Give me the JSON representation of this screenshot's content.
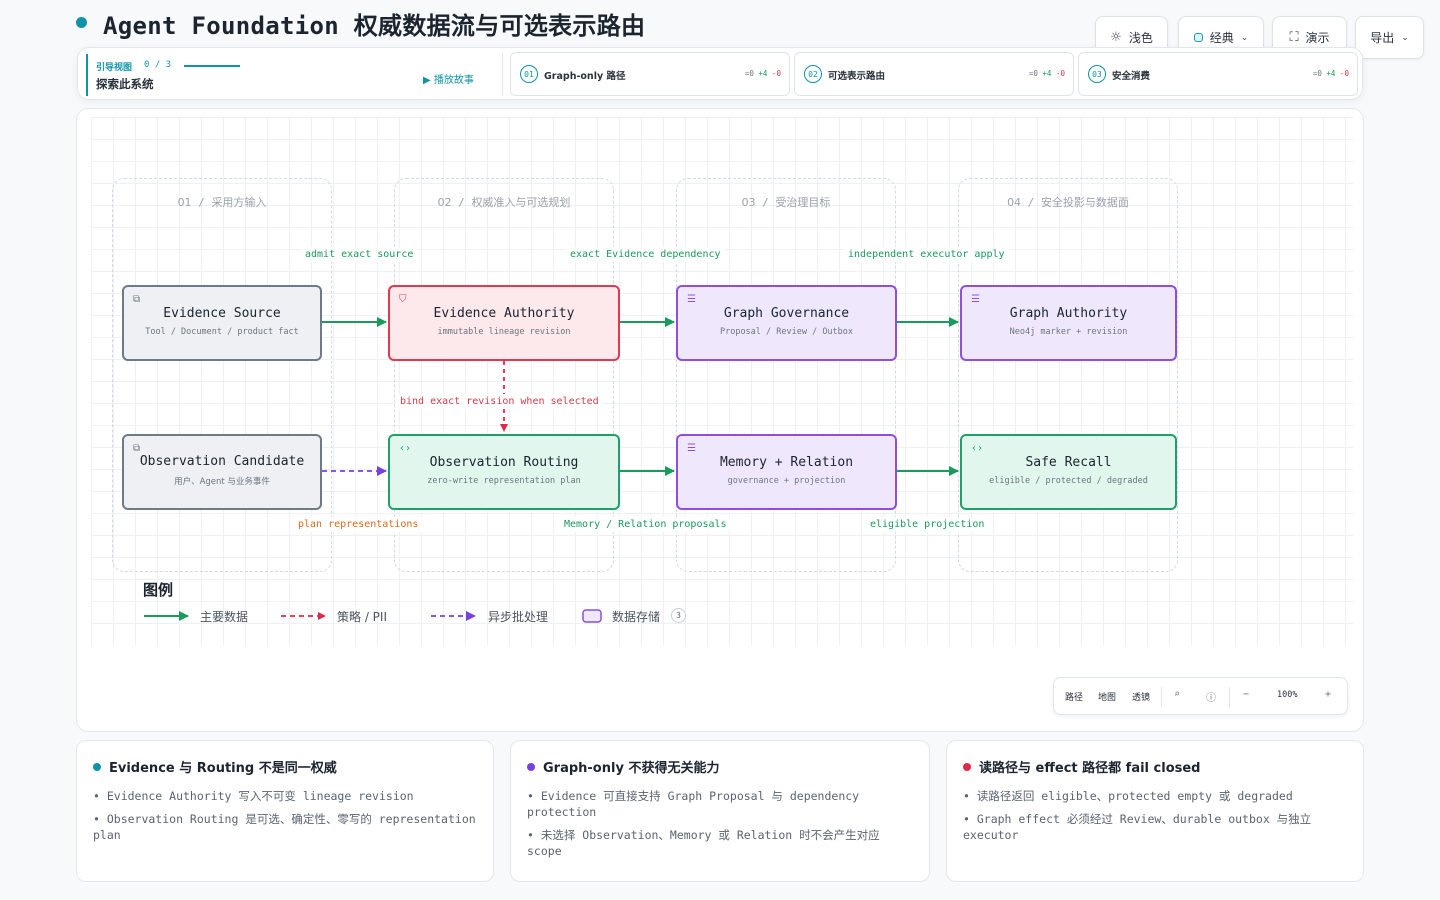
{
  "page": {
    "title": "Agent Foundation 权威数据流与可选表示路由"
  },
  "controls": {
    "theme": "浅色",
    "style": "经典",
    "present": "演示",
    "export": "导出"
  },
  "guide": {
    "label": "引导视图",
    "count": "0 / 3",
    "subtitle": "探索此系统",
    "play": "播放故事",
    "steps": [
      {
        "num": "01",
        "label": "Graph-only 路径",
        "eq": "=0",
        "add": "+4",
        "del": "-0"
      },
      {
        "num": "02",
        "label": "可选表示路由",
        "eq": "=0",
        "add": "+4",
        "del": "-0"
      },
      {
        "num": "03",
        "label": "安全消费",
        "eq": "=0",
        "add": "+4",
        "del": "-0"
      }
    ]
  },
  "lanes": [
    {
      "num": "01",
      "title": "采用方输入"
    },
    {
      "num": "02",
      "title": "权威准入与可选规划"
    },
    {
      "num": "03",
      "title": "受治理目标"
    },
    {
      "num": "04",
      "title": "安全投影与数据面"
    }
  ],
  "nodes": {
    "evidence_source": {
      "title": "Evidence Source",
      "sub": "Tool / Document / product fact"
    },
    "evidence_authority": {
      "title": "Evidence Authority",
      "sub": "immutable lineage revision"
    },
    "graph_governance": {
      "title": "Graph Governance",
      "sub": "Proposal / Review / Outbox"
    },
    "graph_authority": {
      "title": "Graph Authority",
      "sub": "Neo4j marker + revision"
    },
    "observation_candidate": {
      "title": "Observation Candidate",
      "sub": "用户、Agent 与业务事件"
    },
    "observation_routing": {
      "title": "Observation Routing",
      "sub": "zero-write representation plan"
    },
    "memory_relation": {
      "title": "Memory + Relation",
      "sub": "governance + projection"
    },
    "safe_recall": {
      "title": "Safe Recall",
      "sub": "eligible / protected / degraded"
    }
  },
  "edges": {
    "admit": "admit exact source",
    "dependency": "exact Evidence dependency",
    "executor": "independent executor apply",
    "bind": "bind exact revision when selected",
    "plan": "plan representations",
    "proposals": "Memory / Relation proposals",
    "projection": "eligible projection"
  },
  "legend": {
    "title": "图例",
    "main": "主要数据",
    "policy": "策略 / PII",
    "async": "异步批处理",
    "store": "数据存储",
    "store_count": "3"
  },
  "toolbar": {
    "path": "路径",
    "map": "地图",
    "lens": "透镜",
    "zoom": "100%",
    "minus": "−",
    "plus": "+"
  },
  "cards": [
    {
      "color": "#1093a9",
      "title": "Evidence 与 Routing 不是同一权威",
      "lines": [
        "• Evidence Authority 写入不可变 lineage revision",
        "• Observation Routing 是可选、确定性、零写的 representation plan"
      ]
    },
    {
      "color": "#7a3fe0",
      "title": "Graph-only 不获得无关能力",
      "lines": [
        "• Evidence 可直接支持 Graph Proposal 与 dependency protection",
        "• 未选择 Observation、Memory 或 Relation 时不会产生对应 scope"
      ]
    },
    {
      "color": "#e0294a",
      "title": "读路径与 effect 路径都 fail closed",
      "lines": [
        "• 读路径返回 eligible、protected empty 或 degraded",
        "• Graph effect 必须经过 Review、durable outbox 与独立 executor"
      ]
    }
  ],
  "colors": {
    "accent": "#1093a9",
    "main_edge": "#1a9a5c",
    "policy_edge": "#e0294a",
    "async_edge": "#7a3fe0"
  }
}
